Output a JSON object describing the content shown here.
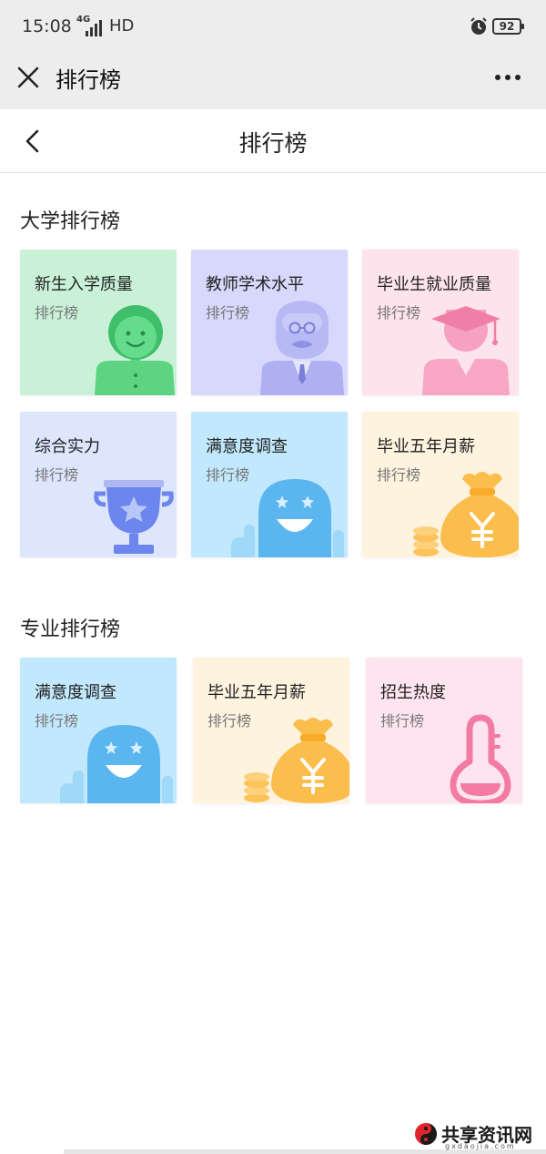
{
  "status_bar": {
    "time": "15:08",
    "network": "4G",
    "hd": "HD",
    "battery": "92"
  },
  "wechat_bar": {
    "title": "排行榜"
  },
  "page_header": {
    "title": "排行榜"
  },
  "sections": [
    {
      "title": "大学排行榜",
      "cards": [
        {
          "title": "新生入学质量",
          "subtitle": "排行榜",
          "icon": "student-icon"
        },
        {
          "title": "教师学术水平",
          "subtitle": "排行榜",
          "icon": "professor-icon"
        },
        {
          "title": "毕业生就业质量",
          "subtitle": "排行榜",
          "icon": "graduate-icon"
        },
        {
          "title": "综合实力",
          "subtitle": "排行榜",
          "icon": "trophy-icon"
        },
        {
          "title": "满意度调查",
          "subtitle": "排行榜",
          "icon": "smiley-icon"
        },
        {
          "title": "毕业五年月薪",
          "subtitle": "排行榜",
          "icon": "money-bag-icon"
        }
      ]
    },
    {
      "title": "专业排行榜",
      "cards": [
        {
          "title": "满意度调查",
          "subtitle": "排行榜",
          "icon": "smiley-icon"
        },
        {
          "title": "毕业五年月薪",
          "subtitle": "排行榜",
          "icon": "money-bag-icon"
        },
        {
          "title": "招生热度",
          "subtitle": "排行榜",
          "icon": "thermometer-icon"
        }
      ]
    }
  ],
  "watermark": {
    "text": "共享资讯网",
    "sub": "gxdaojia.com"
  }
}
